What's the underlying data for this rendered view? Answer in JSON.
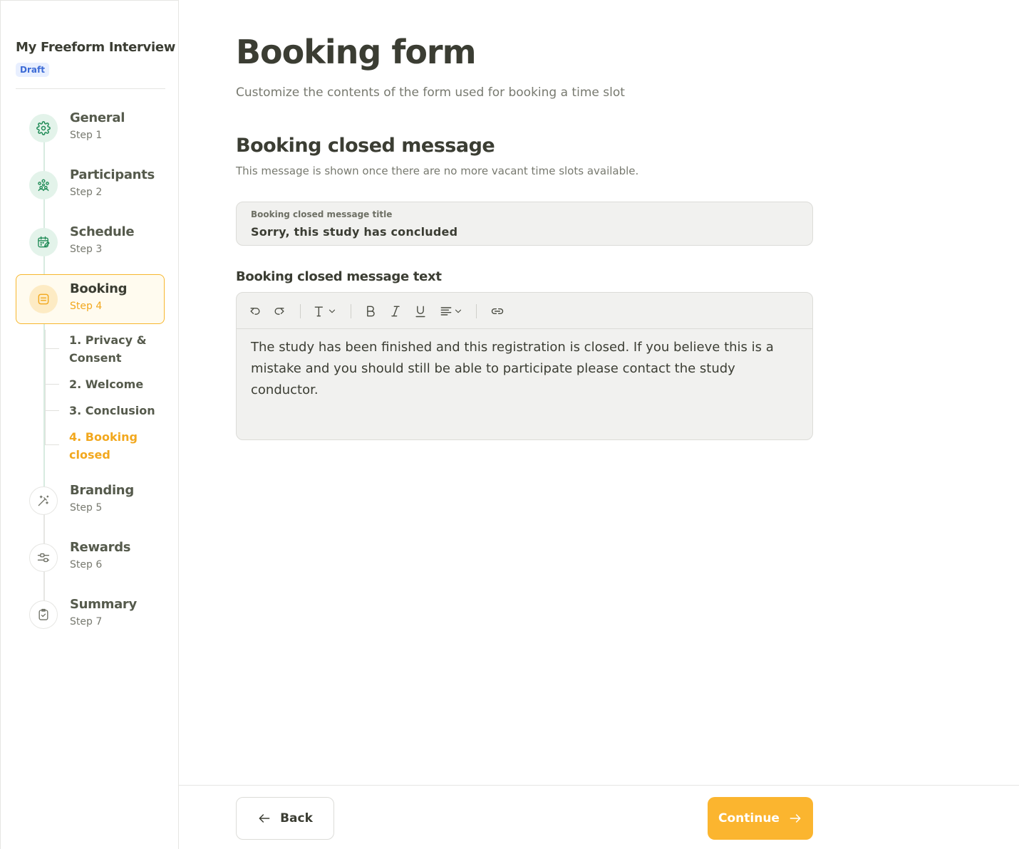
{
  "sidebar": {
    "study_title": "My Freeform Interview",
    "status_badge": "Draft",
    "steps": [
      {
        "name": "General",
        "sub": "Step 1",
        "icon": "gear-icon"
      },
      {
        "name": "Participants",
        "sub": "Step 2",
        "icon": "people-icon"
      },
      {
        "name": "Schedule",
        "sub": "Step 3",
        "icon": "calendar-icon"
      },
      {
        "name": "Booking",
        "sub": "Step 4",
        "icon": "form-icon"
      },
      {
        "name": "Branding",
        "sub": "Step 5",
        "icon": "magic-wand-icon"
      },
      {
        "name": "Rewards",
        "sub": "Step 6",
        "icon": "sliders-icon"
      },
      {
        "name": "Summary",
        "sub": "Step 7",
        "icon": "clipboard-check-icon"
      }
    ],
    "active_step": "Booking",
    "substeps": [
      {
        "label": "1. Privacy & Consent"
      },
      {
        "label": "2. Welcome"
      },
      {
        "label": "3. Conclusion"
      },
      {
        "label": "4. Booking closed"
      }
    ],
    "current_substep": "4. Booking closed"
  },
  "main": {
    "title": "Booking form",
    "description": "Customize the contents of the form used for booking a time slot",
    "section_title": "Booking closed message",
    "section_description": "This message is shown once there are no more vacant time slots available.",
    "title_field": {
      "label": "Booking closed message title",
      "value": "Sorry, this study has concluded"
    },
    "text_field": {
      "label": "Booking closed message text",
      "value": "The study has been finished and this registration is closed. If you believe this is a mistake and you should still be able to participate please contact the study conductor."
    }
  },
  "footer": {
    "back_label": "Back",
    "continue_label": "Continue"
  },
  "colors": {
    "accent": "#fbb52f",
    "active_text": "#f2a81e",
    "step_icon_bg": "#e3f3ea",
    "step_icon_fg": "#1e8a55",
    "badge_bg": "#e8efff",
    "badge_fg": "#3d6bd6"
  }
}
